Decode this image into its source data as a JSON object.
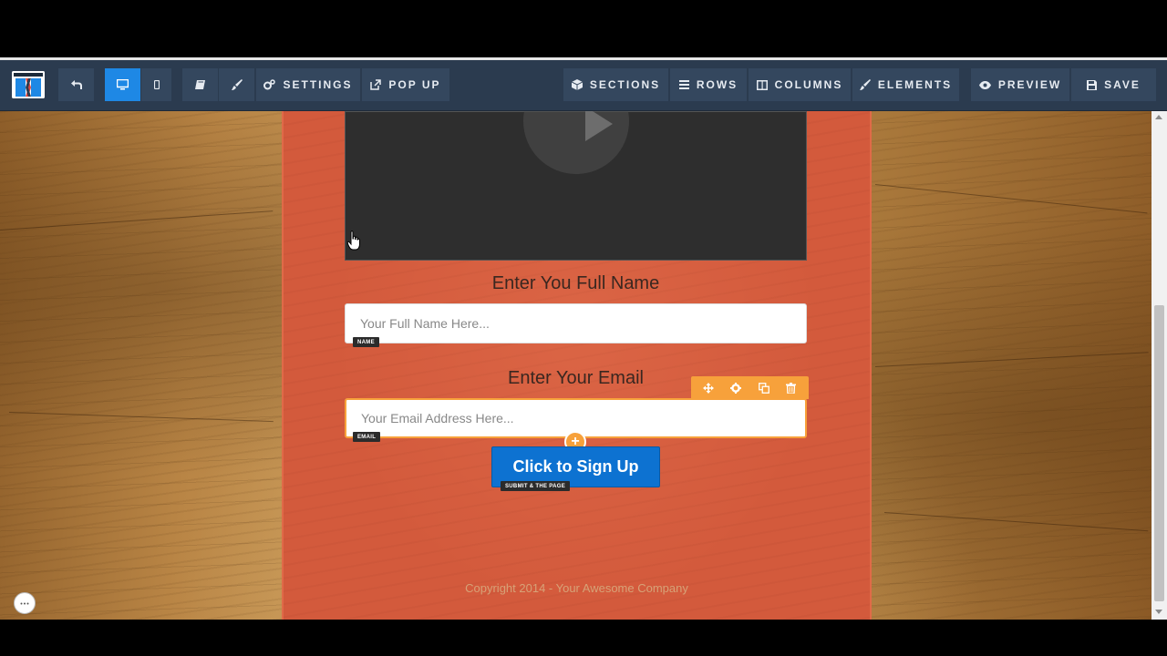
{
  "toolbar": {
    "settings_label": "SETTINGS",
    "popup_label": "POP UP",
    "sections_label": "SECTIONS",
    "rows_label": "ROWS",
    "columns_label": "COLUMNS",
    "elements_label": "ELEMENTS",
    "preview_label": "PREVIEW",
    "save_label": "SAVE",
    "active_view": "desktop"
  },
  "form": {
    "name_label": "Enter You Full Name",
    "name_placeholder": "Your Full Name Here...",
    "name_tag": "NAME",
    "email_label": "Enter Your Email",
    "email_placeholder": "Your Email Address Here...",
    "email_tag": "EMAIL",
    "submit_label": "Click to Sign Up",
    "submit_tag": "SUBMIT & THE PAGE"
  },
  "footer": {
    "copyright": "Copyright 2014 - Your Awesome Company"
  },
  "colors": {
    "toolbar_bg": "#2b3b4f",
    "accent_blue": "#1e88e5",
    "panel_orange": "#d35a3c",
    "selection_orange": "#f7a13b",
    "cta_blue": "#0d72d1"
  }
}
